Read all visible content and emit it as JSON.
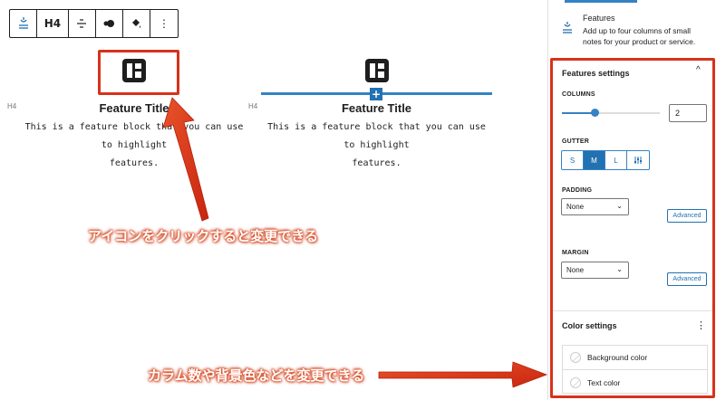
{
  "toolbar": {
    "items": [
      {
        "icon": "features-block-icon"
      },
      {
        "label": "H4"
      },
      {
        "icon": "align-icon"
      },
      {
        "icon": "block-style-icon"
      },
      {
        "icon": "fill-icon"
      },
      {
        "icon": "more-options-icon"
      }
    ]
  },
  "editor": {
    "heading_tag": "H4",
    "columns": [
      {
        "title": "Feature Title",
        "text_line1": "This is a feature block that you can use to highlight",
        "text_line2": "features."
      },
      {
        "title": "Feature Title",
        "text_line1": "This is a feature block that you can use to highlight",
        "text_line2": "features."
      }
    ],
    "inserter_label": "+"
  },
  "annotations": {
    "icon_note": "アイコンをクリックすると変更できる",
    "settings_note": "カラム数や背景色などを変更できる"
  },
  "sidebar": {
    "block_title": "Features",
    "block_description": "Add up to four columns of small notes for your product or service.",
    "features_settings_title": "Features settings",
    "columns_label": "COLUMNS",
    "columns_value": "2",
    "columns_fraction": 0.33,
    "gutter_label": "GUTTER",
    "gutter_options": [
      "S",
      "M",
      "L"
    ],
    "gutter_selected": "M",
    "padding_label": "PADDING",
    "padding_value": "None",
    "margin_label": "MARGIN",
    "margin_value": "None",
    "advanced_label": "Advanced",
    "color_settings_title": "Color settings",
    "background_color_label": "Background color",
    "text_color_label": "Text color",
    "collapse_glyph": "^",
    "more_glyph": "⋮"
  },
  "colors": {
    "accent": "#2271b1",
    "annotation": "#d7321a"
  }
}
